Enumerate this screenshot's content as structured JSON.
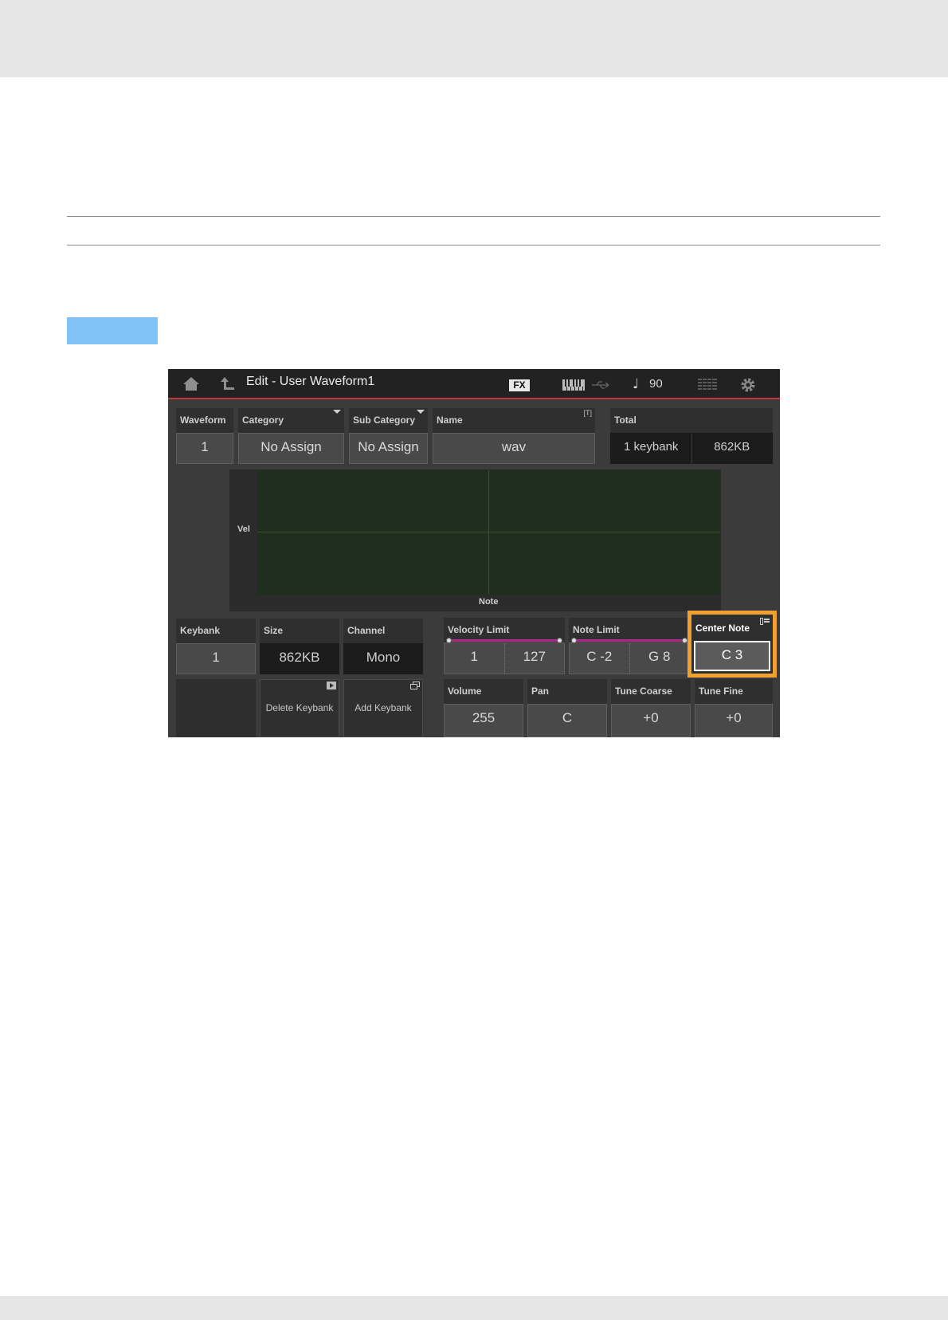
{
  "screen": {
    "title": "Edit - User Waveform1",
    "fx_badge": "FX",
    "tempo_symbol": "♩",
    "tempo": "90",
    "icons": [
      "home-icon",
      "back-arrow-icon",
      "keyboard-icon",
      "usb-icon",
      "grid-icon",
      "gear-icon"
    ]
  },
  "fields": {
    "waveform": {
      "label": "Waveform",
      "value": "1"
    },
    "category": {
      "label": "Category",
      "value": "No Assign"
    },
    "sub_category": {
      "label": "Sub Category",
      "value": "No Assign"
    },
    "name": {
      "label": "Name",
      "value": "wav",
      "tag": "[T]"
    },
    "total": {
      "label": "Total",
      "keybanks": "1 keybank",
      "size": "862KB"
    },
    "keybank": {
      "label": "Keybank",
      "value": "1"
    },
    "size": {
      "label": "Size",
      "value": "862KB"
    },
    "channel": {
      "label": "Channel",
      "value": "Mono"
    },
    "velocity_limit": {
      "label": "Velocity Limit",
      "low": "1",
      "high": "127"
    },
    "note_limit": {
      "label": "Note Limit",
      "low": "C -2",
      "high": "G 8"
    },
    "center_note": {
      "label": "Center Note",
      "value": "C 3"
    },
    "volume": {
      "label": "Volume",
      "value": "255"
    },
    "pan": {
      "label": "Pan",
      "value": "C"
    },
    "tune_coarse": {
      "label": "Tune Coarse",
      "value": "+0"
    },
    "tune_fine": {
      "label": "Tune Fine",
      "value": "+0"
    }
  },
  "graph": {
    "y_label": "Vel",
    "x_label": "Note"
  },
  "buttons": {
    "delete_keybank": "Delete Keybank",
    "add_keybank": "Add Keybank"
  },
  "colors": {
    "accent_red": "#c6373b",
    "highlight_orange": "#f0a030",
    "limit_bar": "#b02a8c",
    "page_tab_blue": "#82c3f7"
  }
}
